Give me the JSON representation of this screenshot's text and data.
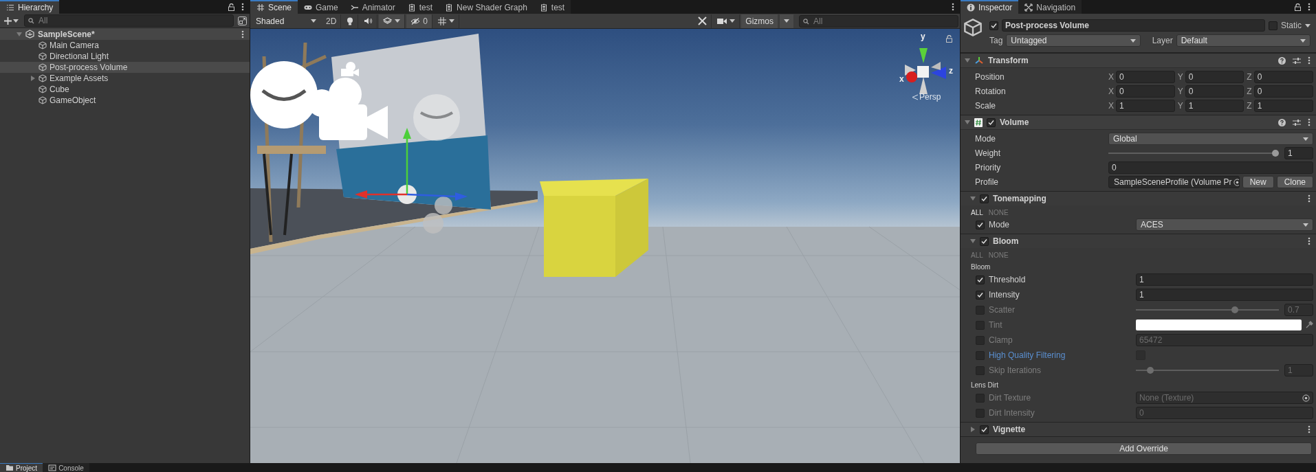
{
  "hierarchy": {
    "title": "Hierarchy",
    "search": {
      "placeholder": "All"
    },
    "scene": {
      "name": "SampleScene*",
      "expanded": true,
      "children": [
        {
          "name": "Main Camera",
          "kind": "object",
          "selected": false
        },
        {
          "name": "Directional Light",
          "kind": "object",
          "selected": false
        },
        {
          "name": "Post-process Volume",
          "kind": "object",
          "selected": true
        },
        {
          "name": "Example Assets",
          "kind": "group",
          "expanded": false,
          "selected": false
        },
        {
          "name": "Cube",
          "kind": "object",
          "selected": false
        },
        {
          "name": "GameObject",
          "kind": "object",
          "selected": false
        }
      ]
    }
  },
  "scene_view": {
    "tabs": [
      {
        "label": "Scene",
        "kind": "scene",
        "selected": true
      },
      {
        "label": "Game",
        "kind": "game",
        "selected": false
      },
      {
        "label": "Animator",
        "kind": "animator",
        "selected": false
      },
      {
        "label": "test",
        "kind": "graph",
        "selected": false
      },
      {
        "label": "New Shader Graph",
        "kind": "graph",
        "selected": false
      },
      {
        "label": "test",
        "kind": "graph",
        "selected": false
      }
    ],
    "toolbar": {
      "draw_mode": "Shaded",
      "mode_2d": "2D",
      "hidden_count": "0",
      "gizmos": "Gizmos",
      "search": {
        "placeholder": "All"
      }
    },
    "orientation": {
      "x": "x",
      "y": "y",
      "z": "z",
      "projection": "Persp"
    }
  },
  "inspector": {
    "tabs": [
      {
        "label": "Inspector",
        "selected": true
      },
      {
        "label": "Navigation",
        "selected": false
      }
    ],
    "object": {
      "active": true,
      "name": "Post-process Volume",
      "static": false,
      "static_label": "Static",
      "tag_label": "Tag",
      "tag": "Untagged",
      "layer_label": "Layer",
      "layer": "Default"
    },
    "transform": {
      "title": "Transform",
      "expanded": true,
      "rows": [
        {
          "label": "Position",
          "axes": [
            {
              "axis": "X",
              "value": "0"
            },
            {
              "axis": "Y",
              "value": "0"
            },
            {
              "axis": "Z",
              "value": "0"
            }
          ]
        },
        {
          "label": "Rotation",
          "axes": [
            {
              "axis": "X",
              "value": "0"
            },
            {
              "axis": "Y",
              "value": "0"
            },
            {
              "axis": "Z",
              "value": "0"
            }
          ]
        },
        {
          "label": "Scale",
          "axes": [
            {
              "axis": "X",
              "value": "1"
            },
            {
              "axis": "Y",
              "value": "1"
            },
            {
              "axis": "Z",
              "value": "1"
            }
          ]
        }
      ]
    },
    "volume": {
      "title": "Volume",
      "expanded": true,
      "enabled": true,
      "fields": [
        {
          "kind": "dropdown",
          "label": "Mode",
          "value": "Global"
        },
        {
          "kind": "slider",
          "label": "Weight",
          "level": 1,
          "value": "1"
        },
        {
          "kind": "number",
          "label": "Priority",
          "value": "0"
        },
        {
          "kind": "object",
          "label": "Profile",
          "value": "SampleSceneProfile (Volume Pr",
          "buttons": [
            "New",
            "Clone"
          ]
        }
      ]
    },
    "overrides": [
      {
        "title": "Tonemapping",
        "enabled": true,
        "expanded": true,
        "all": "ALL",
        "all_active": true,
        "none": "NONE",
        "none_active": false,
        "properties": [
          {
            "kind": "dropdown",
            "label": "Mode",
            "overridden": true,
            "value": "ACES"
          }
        ]
      },
      {
        "title": "Bloom",
        "enabled": true,
        "expanded": true,
        "all": "ALL",
        "all_active": false,
        "none": "NONE",
        "none_active": false,
        "properties": [
          {
            "kind": "header",
            "label": "Bloom"
          },
          {
            "kind": "number",
            "label": "Threshold",
            "overridden": true,
            "value": "1"
          },
          {
            "kind": "number",
            "label": "Intensity",
            "overridden": true,
            "value": "1"
          },
          {
            "kind": "slider",
            "label": "Scatter",
            "overridden": false,
            "level": 0.7,
            "value": "0.7"
          },
          {
            "kind": "color",
            "label": "Tint",
            "overridden": false,
            "color": "#ffffff"
          },
          {
            "kind": "number",
            "label": "Clamp",
            "overridden": false,
            "value": "65472"
          },
          {
            "kind": "toggle",
            "label": "High Quality Filtering",
            "overridden": false,
            "highlighted": true,
            "checked": false
          },
          {
            "kind": "slider",
            "label": "Skip Iterations",
            "overridden": false,
            "level": 0.08,
            "value": "1"
          },
          {
            "kind": "header",
            "label": "Lens Dirt"
          },
          {
            "kind": "object",
            "label": "Dirt Texture",
            "overridden": false,
            "value": "None (Texture)"
          },
          {
            "kind": "number",
            "label": "Dirt Intensity",
            "overridden": false,
            "value": "0"
          }
        ]
      },
      {
        "title": "Vignette",
        "enabled": true,
        "expanded": false
      }
    ],
    "add_button": "Add Override"
  },
  "bottom_tabs": [
    {
      "label": "Project",
      "selected": true
    },
    {
      "label": "Console",
      "selected": false
    }
  ]
}
